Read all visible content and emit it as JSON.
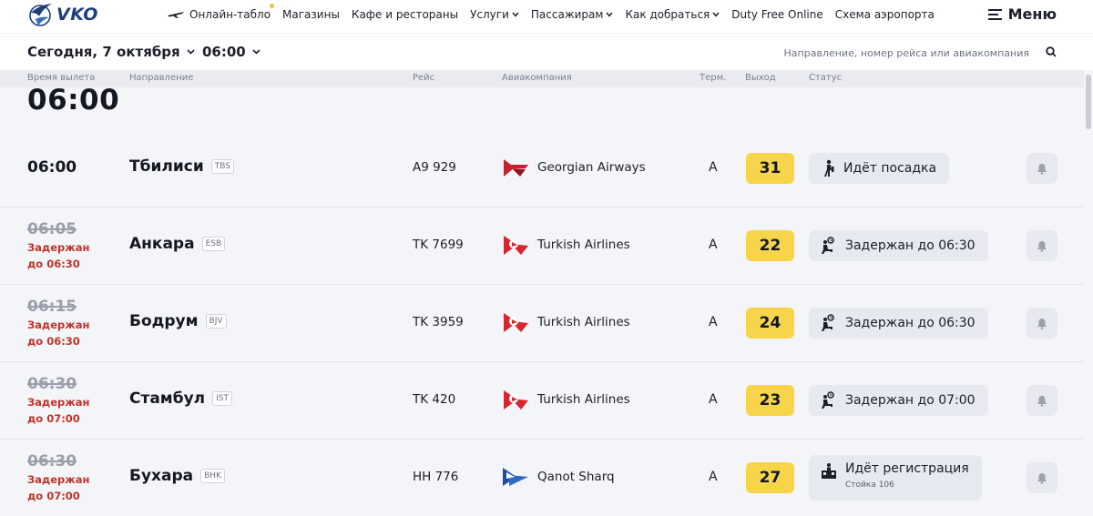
{
  "brand": {
    "name": "VKO"
  },
  "nav": {
    "items": [
      {
        "label": "Онлайн-табло",
        "icon": "plane-icon",
        "dot": true
      },
      {
        "label": "Магазины"
      },
      {
        "label": "Кафе и рестораны"
      },
      {
        "label": "Услуги",
        "dropdown": true
      },
      {
        "label": "Пассажирам",
        "dropdown": true
      },
      {
        "label": "Как добраться",
        "dropdown": true
      },
      {
        "label": "Duty Free Online"
      },
      {
        "label": "Схема аэропорта"
      }
    ],
    "menu_label": "Меню"
  },
  "filters": {
    "date": "Сегодня, 7 октября",
    "time": "06:00",
    "search_placeholder": "Направление, номер рейса или авиакомпания"
  },
  "columns": {
    "time": "Время вылета",
    "destination": "Направление",
    "flight": "Рейс",
    "airline": "Авиакомпания",
    "terminal": "Терм.",
    "gate": "Выход",
    "status": "Статус"
  },
  "time_group": "06:00",
  "flights": [
    {
      "time": "06:00",
      "delayed": false,
      "city": "Тбилиси",
      "iata": "TBS",
      "flight": "A9 929",
      "airline": "Georgian Airways",
      "terminal": "A",
      "gate": "31",
      "status": "Идёт посадка",
      "status_icon": "boarding-icon"
    },
    {
      "time": "06:05",
      "delayed": true,
      "delay_line1": "Задержан",
      "delay_line2": "до 06:30",
      "city": "Анкара",
      "iata": "ESB",
      "flight": "TK 7699",
      "airline": "Turkish Airlines",
      "terminal": "A",
      "gate": "22",
      "status": "Задержан до 06:30",
      "status_icon": "delayed-icon"
    },
    {
      "time": "06:15",
      "delayed": true,
      "delay_line1": "Задержан",
      "delay_line2": "до 06:30",
      "city": "Бодрум",
      "iata": "BJV",
      "flight": "TK 3959",
      "airline": "Turkish Airlines",
      "terminal": "A",
      "gate": "24",
      "status": "Задержан до 06:30",
      "status_icon": "delayed-icon"
    },
    {
      "time": "06:30",
      "delayed": true,
      "delay_line1": "Задержан",
      "delay_line2": "до 07:00",
      "city": "Стамбул",
      "iata": "IST",
      "flight": "TK 420",
      "airline": "Turkish Airlines",
      "terminal": "A",
      "gate": "23",
      "status": "Задержан до 07:00",
      "status_icon": "delayed-icon"
    },
    {
      "time": "06:30",
      "delayed": true,
      "delay_line1": "Задержан",
      "delay_line2": "до 07:00",
      "city": "Бухара",
      "iata": "BHK",
      "flight": "HH 776",
      "airline": "Qanot Sharq",
      "terminal": "A",
      "gate": "27",
      "status": "Идёт регистрация",
      "status_sub": "Стойка 106",
      "status_icon": "checkin-icon"
    }
  ],
  "colors": {
    "gate_bg": "#f6d54a",
    "delay_text": "#c1332b",
    "brand": "#1f3f7a",
    "turkish_red": "#d6262f",
    "georgian_red": "#c8202f",
    "qanot_blue": "#1d4e9e"
  }
}
